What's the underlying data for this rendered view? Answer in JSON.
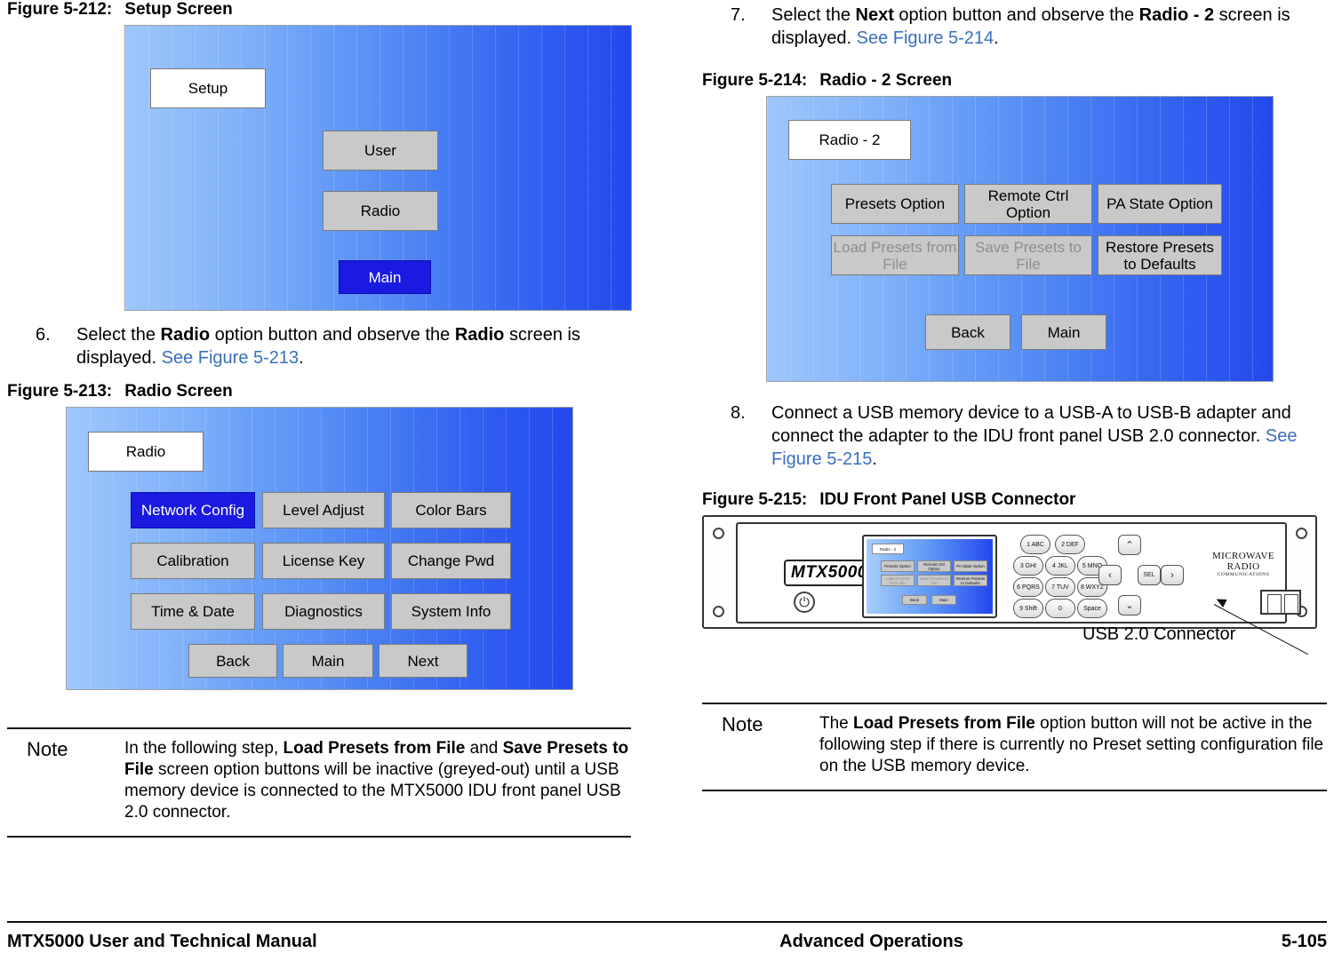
{
  "left_column": {
    "figure_212": {
      "caption_num": "Figure 5-212:",
      "caption_title": "Setup Screen",
      "buttons": {
        "title": "Setup",
        "user": "User",
        "radio": "Radio",
        "main": "Main"
      }
    },
    "step_6": {
      "num": "6.",
      "text_1": "Select the ",
      "bold_1": "Radio",
      "text_2": " option button and observe the ",
      "bold_2": "Radio",
      "text_3": " screen is displayed.  ",
      "xref": "See Figure 5-213",
      "text_4": "."
    },
    "figure_213": {
      "caption_num": "Figure 5-213:",
      "caption_title": "Radio Screen",
      "buttons": {
        "title": "Radio",
        "network_config": "Network Config",
        "level_adjust": "Level Adjust",
        "color_bars": "Color Bars",
        "calibration": "Calibration",
        "license_key": "License Key",
        "change_pwd": "Change Pwd",
        "time_date": "Time & Date",
        "diagnostics": "Diagnostics",
        "system_info": "System Info",
        "back": "Back",
        "main": "Main",
        "next": "Next"
      }
    },
    "note": {
      "label": "Note",
      "text_1": "In the following step, ",
      "bold_1": "Load Presets from File",
      "text_2": " and ",
      "bold_2": "Save Presets to File",
      "text_3": " screen option buttons will be inactive (greyed-out) until a USB memory device is connected to the MTX5000 IDU front panel USB 2.0 connector."
    }
  },
  "right_column": {
    "step_7": {
      "num": "7.",
      "text_1": "Select the ",
      "bold_1": "Next",
      "text_2": " option button and observe the ",
      "bold_2": "Radio - 2",
      "text_3": " screen is displayed.  ",
      "xref": "See Figure 5-214",
      "text_4": "."
    },
    "figure_214": {
      "caption_num": "Figure 5-214:",
      "caption_title": "Radio - 2 Screen",
      "buttons": {
        "title": "Radio - 2",
        "presets_option": "Presets Option",
        "remote_ctrl_option": "Remote Ctrl Option",
        "pa_state_option": "PA State Option",
        "load_presets_from_file": "Load Presets from File",
        "save_presets_to_file": "Save Presets to File",
        "restore_presets_to_defaults": "Restore Presets to Defaults",
        "back": "Back",
        "main": "Main"
      }
    },
    "step_8": {
      "num": "8.",
      "text_1": "Connect a USB memory device to a USB-A to USB-B adapter and connect the adapter to the IDU front panel USB 2.0 connector.  ",
      "xref": "See Figure 5-215",
      "text_2": "."
    },
    "figure_215": {
      "caption_num": "Figure 5-215:",
      "caption_title": "IDU Front Panel USB Connector",
      "callout": "USB 2.0 Connector",
      "panel": {
        "model_logo": "MTX5000",
        "brand_logo": "MICROWAVE RADIO",
        "brand_logo_sub": "COMMUNICATIONS",
        "mini_screen": {
          "title": "Radio - 2",
          "b1": "Presets Option",
          "b2": "Remote Ctrl Option",
          "b3": "PA State Option",
          "b4": "Load Presets from File",
          "b5": "Save Presets to File",
          "b6": "Restore Presets to Defaults",
          "b7": "Back",
          "b8": "Main"
        },
        "keys": [
          "1 ABC",
          "2 DEF",
          "3 GHI",
          "4 JKL",
          "5 MNO",
          "6 PQRS",
          "7 TUV",
          "8 WXYZ",
          "9 Shift",
          "0",
          "Space"
        ],
        "nav": {
          "up": "⌃",
          "left": "‹",
          "sel": "SEL",
          "right": "›",
          "down": "⌄"
        }
      }
    },
    "note": {
      "label": "Note",
      "text_1": "The ",
      "bold_1": "Load Presets from File",
      "text_2": " option button will not be active in the following step if there is currently no Preset setting configuration file on the USB memory device."
    }
  },
  "footer": {
    "left": "MTX5000 User and Technical Manual",
    "center": "Advanced Operations",
    "right": "5-105"
  },
  "colors": {
    "xref": "#3a6fbf",
    "selected_button_bg": "#1a1ae0",
    "button_bg": "#c9c9c9",
    "greyed_text": "#8e8e8e"
  }
}
